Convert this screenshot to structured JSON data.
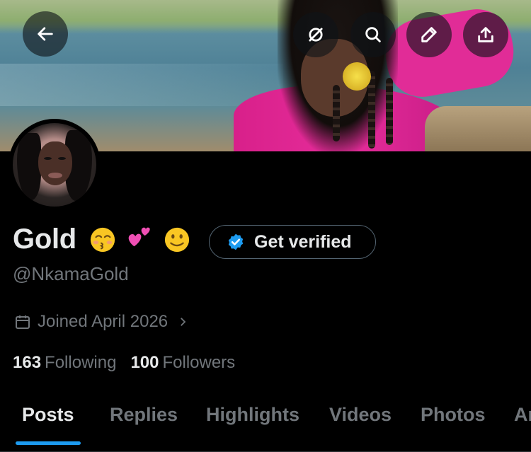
{
  "profile": {
    "display_name": "Gold",
    "emojis": [
      "kissing-face-emoji",
      "two-hearts-emoji",
      "slightly-smiling-face-emoji"
    ],
    "verify_label": "Get verified",
    "handle": "@NkamaGold",
    "joined": "Joined April 2026",
    "following_count": "163",
    "following_label": "Following",
    "followers_count": "100",
    "followers_label": "Followers"
  },
  "header": {
    "icons": [
      "back-arrow-icon",
      "grok-icon",
      "search-icon",
      "edit-icon",
      "share-icon"
    ]
  },
  "tabs": [
    {
      "label": "Posts",
      "active": true
    },
    {
      "label": "Replies",
      "active": false
    },
    {
      "label": "Highlights",
      "active": false
    },
    {
      "label": "Videos",
      "active": false
    },
    {
      "label": "Photos",
      "active": false
    },
    {
      "label": "Ar",
      "active": false
    }
  ],
  "colors": {
    "background": "#000000",
    "primary_text": "#e7e9ea",
    "secondary_text": "#71767b",
    "accent": "#1d9bf0",
    "border": "#536471"
  }
}
